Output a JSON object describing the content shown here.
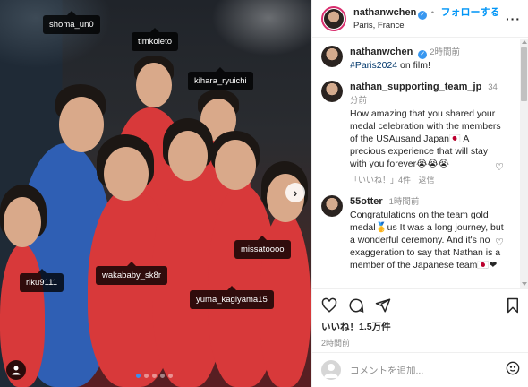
{
  "photo": {
    "tags": [
      {
        "id": "shoma",
        "label": "shoma_un0"
      },
      {
        "id": "timkoleto",
        "label": "timkoleto"
      },
      {
        "id": "kihara",
        "label": "kihara_ryuichi"
      },
      {
        "id": "missato",
        "label": "missatoooo"
      },
      {
        "id": "wakababy",
        "label": "wakababy_sk8r"
      },
      {
        "id": "riku",
        "label": "riku9111"
      },
      {
        "id": "yuma",
        "label": "yuma_kagiyama15"
      }
    ],
    "next_glyph": "›",
    "carousel_count": 5
  },
  "header": {
    "username": "nathanwchen",
    "separator": "•",
    "follow": "フォローする",
    "location": "Paris, France",
    "more": "···"
  },
  "caption": {
    "username": "nathanwchen",
    "time": "2時間前",
    "hashtag": "#Paris2024",
    "text": " on film!"
  },
  "comments": [
    {
      "username": "nathan_supporting_team_jp",
      "time": "34分前",
      "text": "How amazing that you shared your medal celebration with the members of the USAusand Japan🇯🇵 A precious experience that will stay with you forever😭😭😭",
      "likes": "「いいね！」4件",
      "reply": "返信"
    },
    {
      "username": "55otter",
      "time": "1時間前",
      "text": "Congratulations on the team gold medal🥇us It was a long journey, but a wonderful ceremony. And it's no exaggeration to say that Nathan is a member of the Japanese team🇯🇵❤"
    }
  ],
  "actions": {
    "likes": "いいね！1.5万件",
    "posted": "2時間前"
  },
  "add_comment": {
    "placeholder": "コメントを追加..."
  }
}
